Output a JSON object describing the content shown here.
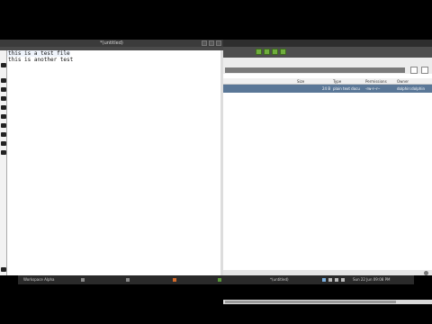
{
  "editor": {
    "title": "*(untitled)",
    "lines": [
      "this is a test file",
      "this is another test"
    ]
  },
  "file_manager": {
    "title": "",
    "columns": {
      "size": "Size",
      "type": "Type",
      "permissions": "Permissions",
      "owner": "Owner"
    },
    "rows": [
      {
        "size": "24 B",
        "type": "plain text docu",
        "permissions": "-rw-r--r--",
        "owner": "dolphin:dolphin"
      }
    ]
  },
  "taskbar": {
    "workspace_label": "Workspace Alpha",
    "window_label": "*(untitled)",
    "clock": "Sun 22 Jun 09:08 PM"
  }
}
